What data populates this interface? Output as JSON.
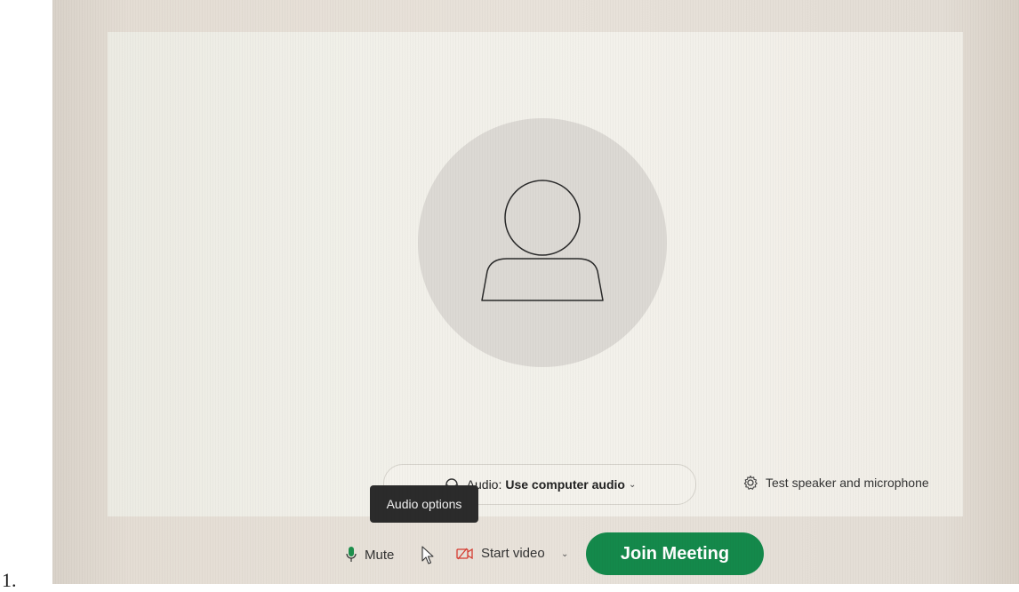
{
  "list_marker": "1.",
  "avatar": {
    "icon": "person-icon"
  },
  "audio": {
    "label": "Audio:",
    "value": "Use computer audio",
    "icon": "headset-icon",
    "chevron": "chevron-down-icon"
  },
  "test": {
    "label": "Test speaker and microphone",
    "icon": "gear-icon"
  },
  "tooltip": {
    "text": "Audio options"
  },
  "toolbar": {
    "mute_label": "Mute",
    "mute_icon": "microphone-icon",
    "video_label": "Start video",
    "video_icon": "video-off-icon",
    "join_label": "Join Meeting"
  },
  "colors": {
    "join_green": "#14894b",
    "mic_green": "#1d8f4c",
    "video_red": "#d63b30",
    "tooltip_bg": "#2b2b2b"
  }
}
